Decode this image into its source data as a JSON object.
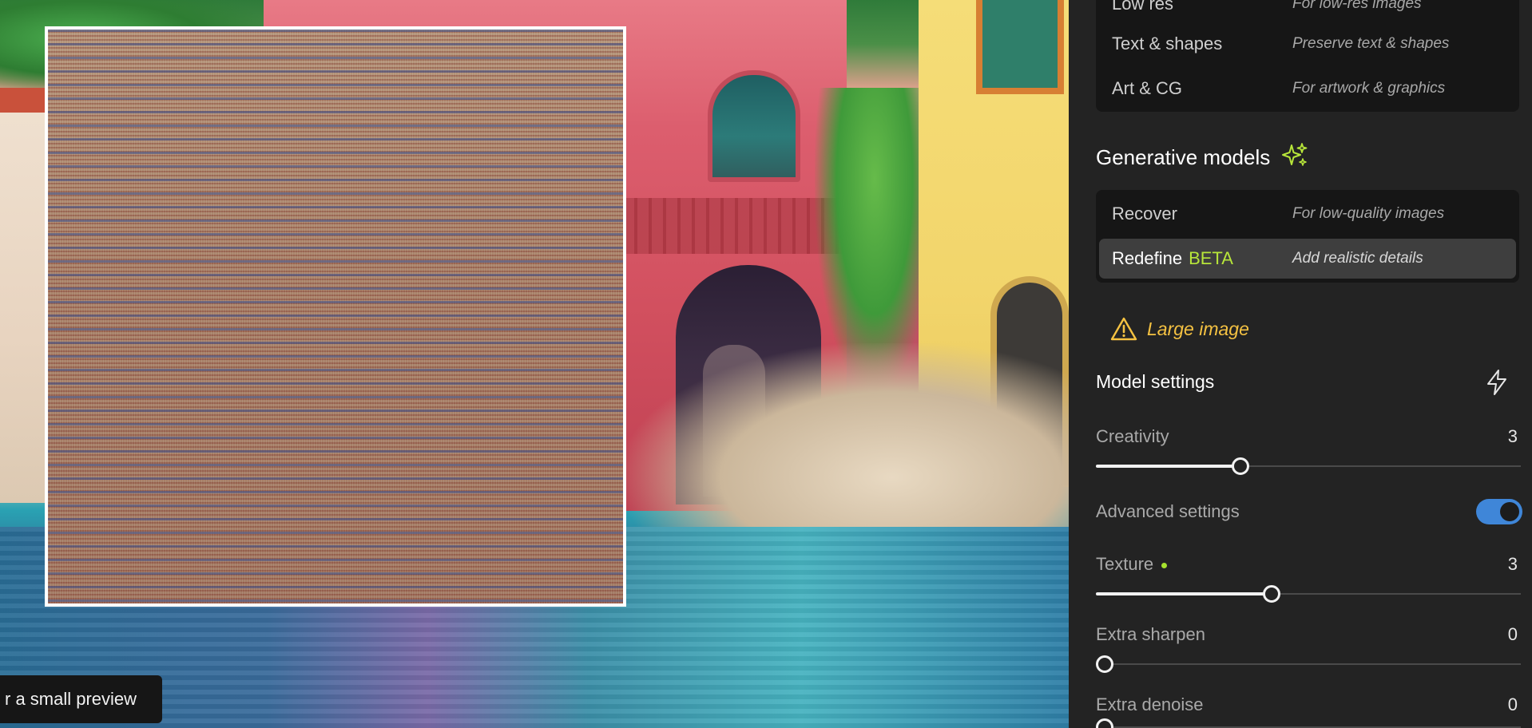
{
  "preview": {
    "tooltip": "r a small preview"
  },
  "panel": {
    "models_top": [
      {
        "name": "Low res",
        "description": "For low-res images"
      },
      {
        "name": "Text & shapes",
        "description": "Preserve text & shapes"
      },
      {
        "name": "Art & CG",
        "description": "For artwork & graphics"
      }
    ],
    "generative_title": "Generative models",
    "generative_models": [
      {
        "name": "Recover",
        "description": "For low-quality images"
      },
      {
        "name": "Redefine",
        "badge": "BETA",
        "description": "Add realistic details"
      }
    ],
    "warning": "Large image",
    "settings_title": "Model settings",
    "settings": {
      "creativity": {
        "label": "Creativity",
        "value": "3",
        "fraction": 0.333
      },
      "advanced": {
        "label": "Advanced settings",
        "enabled": true
      },
      "texture": {
        "label": "Texture",
        "value": "3",
        "fraction": 0.41
      },
      "extra_sharpen": {
        "label": "Extra sharpen",
        "value": "0",
        "fraction": 0
      },
      "extra_denoise": {
        "label": "Extra denoise",
        "value": "0",
        "fraction": 0
      }
    }
  },
  "colors": {
    "accent_green": "#b7e53a",
    "warning_yellow": "#f5c242",
    "toggle_blue": "#3f86d8"
  },
  "icons": {
    "sparkle": "sparkles-icon",
    "warning": "warning-triangle-icon",
    "bolt": "lightning-bolt-icon"
  }
}
